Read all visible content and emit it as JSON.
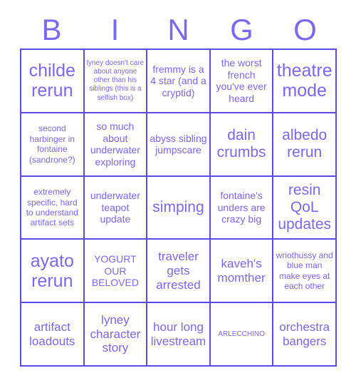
{
  "card": {
    "title_letters": [
      "B",
      "I",
      "N",
      "G",
      "O"
    ],
    "accent_color": "#7b68f5",
    "border_color": "#5b4be8",
    "background_color": "#ffffff",
    "columns": 5,
    "rows": 5
  },
  "cells": [
    {
      "text": "childe rerun",
      "size": "xl"
    },
    {
      "text": "lyney doesn't care about anyone other than his siblings (this is a selfish box)",
      "size": "xxs"
    },
    {
      "text": "fremmy is a 4 star (and a cryptid)",
      "size": "sm"
    },
    {
      "text": "the worst french you've ever heard",
      "size": "sm"
    },
    {
      "text": "theatre mode",
      "size": "xl"
    },
    {
      "text": "second harbinger in fontaine (sandrone?)",
      "size": "xs"
    },
    {
      "text": "so much about underwater exploring",
      "size": "sm"
    },
    {
      "text": "abyss sibling jumpscare",
      "size": "sm"
    },
    {
      "text": "dain crumbs",
      "size": "lg"
    },
    {
      "text": "albedo rerun",
      "size": "lg"
    },
    {
      "text": "extremely specific, hard to understand artifact sets",
      "size": "xs"
    },
    {
      "text": "underwater teapot update",
      "size": "sm"
    },
    {
      "text": "simping",
      "size": "lg"
    },
    {
      "text": "fontaine's unders are crazy big",
      "size": "sm"
    },
    {
      "text": "resin QoL updates",
      "size": "lg"
    },
    {
      "text": "ayato rerun",
      "size": "xl"
    },
    {
      "text": "YOGURT OUR BELOVED",
      "size": "sm"
    },
    {
      "text": "traveler gets arrested",
      "size": "md"
    },
    {
      "text": "kaveh's momther",
      "size": "md"
    },
    {
      "text": "wriothussy and blue man make eyes at each other",
      "size": "xs"
    },
    {
      "text": "artifact loadouts",
      "size": "md"
    },
    {
      "text": "lyney character story",
      "size": "md"
    },
    {
      "text": "hour long livestream",
      "size": "md"
    },
    {
      "text": "ARLECCHINO",
      "size": "xxs"
    },
    {
      "text": "orchestra bangers",
      "size": "md"
    }
  ]
}
